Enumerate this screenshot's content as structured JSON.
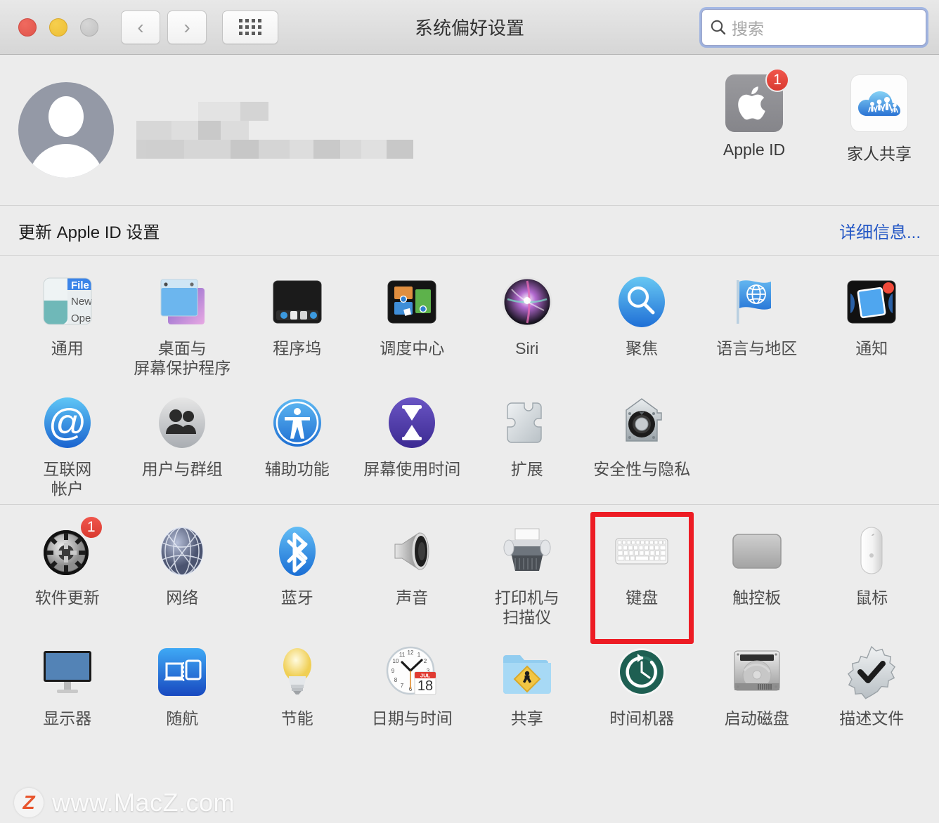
{
  "window": {
    "title": "系统偏好设置",
    "traffic_lights": [
      "close",
      "minimize",
      "zoom"
    ],
    "back_label": "‹",
    "forward_label": "›",
    "grid_label": "show-all-grid"
  },
  "search": {
    "placeholder": "搜索",
    "value": "",
    "icon": "search-icon",
    "focused": true,
    "focus_ring_color": "#6e91e1"
  },
  "account": {
    "avatar": "default-user-avatar",
    "name_redacted": true,
    "tiles": [
      {
        "label": "Apple ID",
        "icon": "apple-logo-icon",
        "badge": "1"
      },
      {
        "label": "家人共享",
        "icon": "family-sharing-cloud-icon",
        "badge": ""
      }
    ]
  },
  "update_banner": {
    "message": "更新 Apple ID 设置",
    "link": "详细信息...",
    "link_color": "#2457c5"
  },
  "sections": [
    {
      "name": "personal-and-system",
      "rows": [
        [
          {
            "label": "通用",
            "icon": "general-icon"
          },
          {
            "label": "桌面与\n屏幕保护程序",
            "icon": "desktop-screensaver-icon"
          },
          {
            "label": "程序坞",
            "icon": "dock-icon"
          },
          {
            "label": "调度中心",
            "icon": "mission-control-icon"
          },
          {
            "label": "Siri",
            "icon": "siri-icon"
          },
          {
            "label": "聚焦",
            "icon": "spotlight-icon"
          },
          {
            "label": "语言与地区",
            "icon": "language-region-icon"
          },
          {
            "label": "通知",
            "icon": "notifications-icon"
          }
        ],
        [
          {
            "label": "互联网\n帐户",
            "icon": "internet-accounts-icon"
          },
          {
            "label": "用户与群组",
            "icon": "users-groups-icon"
          },
          {
            "label": "辅助功能",
            "icon": "accessibility-icon"
          },
          {
            "label": "屏幕使用时间",
            "icon": "screen-time-icon"
          },
          {
            "label": "扩展",
            "icon": "extensions-puzzle-icon"
          },
          {
            "label": "安全性与隐私",
            "icon": "security-privacy-icon"
          },
          {
            "label": "",
            "icon": ""
          },
          {
            "label": "",
            "icon": ""
          }
        ]
      ]
    },
    {
      "name": "hardware-and-services",
      "rows": [
        [
          {
            "label": "软件更新",
            "icon": "software-update-icon",
            "badge": "1"
          },
          {
            "label": "网络",
            "icon": "network-globe-icon"
          },
          {
            "label": "蓝牙",
            "icon": "bluetooth-icon"
          },
          {
            "label": "声音",
            "icon": "sound-speaker-icon"
          },
          {
            "label": "打印机与\n扫描仪",
            "icon": "printers-scanners-icon"
          },
          {
            "label": "键盘",
            "icon": "keyboard-icon",
            "highlighted": true
          },
          {
            "label": "触控板",
            "icon": "trackpad-icon"
          },
          {
            "label": "鼠标",
            "icon": "mouse-icon"
          }
        ],
        [
          {
            "label": "显示器",
            "icon": "displays-icon"
          },
          {
            "label": "随航",
            "icon": "sidecar-icon"
          },
          {
            "label": "节能",
            "icon": "energy-saver-bulb-icon"
          },
          {
            "label": "日期与时间",
            "icon": "date-time-icon",
            "month": "JUL",
            "day": "18"
          },
          {
            "label": "共享",
            "icon": "sharing-folder-icon"
          },
          {
            "label": "时间机器",
            "icon": "time-machine-icon"
          },
          {
            "label": "启动磁盘",
            "icon": "startup-disk-icon"
          },
          {
            "label": "描述文件",
            "icon": "profiles-icon"
          }
        ]
      ]
    }
  ],
  "highlight": {
    "color": "#ed1c24",
    "target": "键盘"
  },
  "watermark": {
    "logo": "Z",
    "text": "www.MacZ.com"
  }
}
